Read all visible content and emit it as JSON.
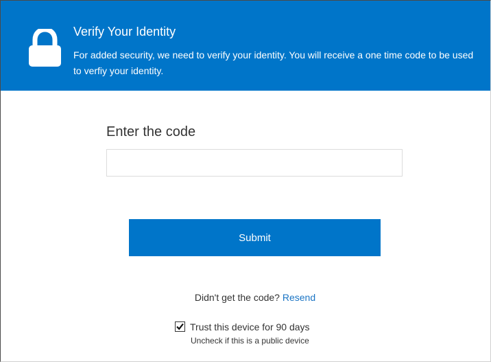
{
  "header": {
    "title": "Verify Your Identity",
    "description": "For added security, we need to verify your identity. You will receive a one time code to be used to verfiy your identity.",
    "icon": "lock-icon"
  },
  "form": {
    "code_label": "Enter the code",
    "code_value": "",
    "code_placeholder": "",
    "submit_label": "Submit"
  },
  "resend": {
    "prompt": "Didn't get the code?",
    "link_label": "Resend"
  },
  "trust": {
    "checked": true,
    "label": "Trust this device for 90 days",
    "note": "Uncheck if this is a public device"
  },
  "colors": {
    "header_bg": "#0075c9",
    "button_bg": "#0075c9",
    "link": "#1a74c4",
    "text": "#333333"
  }
}
